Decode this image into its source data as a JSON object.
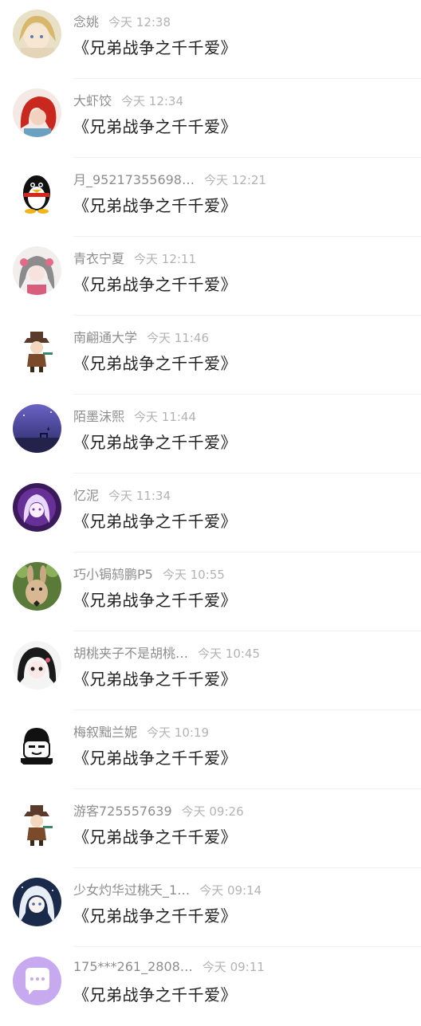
{
  "comments": [
    {
      "name": "念姚",
      "time": "今天 12:38",
      "text": "《兄弟战争之千千爱》",
      "avatar": "anime-girl-avatar"
    },
    {
      "name": "大虾饺",
      "time": "今天 12:34",
      "text": "《兄弟战争之千千爱》",
      "avatar": "mermaid-avatar"
    },
    {
      "name": "月_95217355698…",
      "time": "今天 12:21",
      "text": "《兄弟战争之千千爱》",
      "avatar": "penguin-avatar"
    },
    {
      "name": "青衣宁夏",
      "time": "今天 12:11",
      "text": "《兄弟战争之千千爱》",
      "avatar": "anime-girl-avatar"
    },
    {
      "name": "南翩通大学",
      "time": "今天 11:46",
      "text": "《兄弟战争之千千爱》",
      "avatar": "chibi-avatar"
    },
    {
      "name": "陌墨沫熙",
      "time": "今天 11:44",
      "text": "《兄弟战争之千千爱》",
      "avatar": "purple-deer-avatar"
    },
    {
      "name": "忆泥",
      "time": "今天 11:34",
      "text": "《兄弟战争之千千爱》",
      "avatar": "purple-girl-avatar"
    },
    {
      "name": "巧小锔鸫鹏P5",
      "time": "今天 10:55",
      "text": "《兄弟战争之千千爱》",
      "avatar": "bunny-avatar"
    },
    {
      "name": "胡桃夹子不是胡桃…",
      "time": "今天 10:45",
      "text": "《兄弟战争之千千爱》",
      "avatar": "manga-girl-avatar"
    },
    {
      "name": "梅叙黜兰妮",
      "time": "今天 10:19",
      "text": "《兄弟战争之千千爱》",
      "avatar": "meme-face-avatar"
    },
    {
      "name": "游客725557639",
      "time": "今天 09:26",
      "text": "《兄弟战争之千千爱》",
      "avatar": "chibi-avatar"
    },
    {
      "name": "少女灼华过桃夭_1…",
      "time": "今天 09:14",
      "text": "《兄弟战争之千千爱》",
      "avatar": "white-hair-avatar"
    },
    {
      "name": "175***261_2808…",
      "time": "今天 09:11",
      "text": "《兄弟战争之千千爱》",
      "avatar": "chat-bubble-avatar"
    }
  ],
  "colors": {
    "name": "#8d8d8d",
    "time": "#b3b3b3",
    "text": "#222222",
    "separator": "#f0f0f0"
  }
}
